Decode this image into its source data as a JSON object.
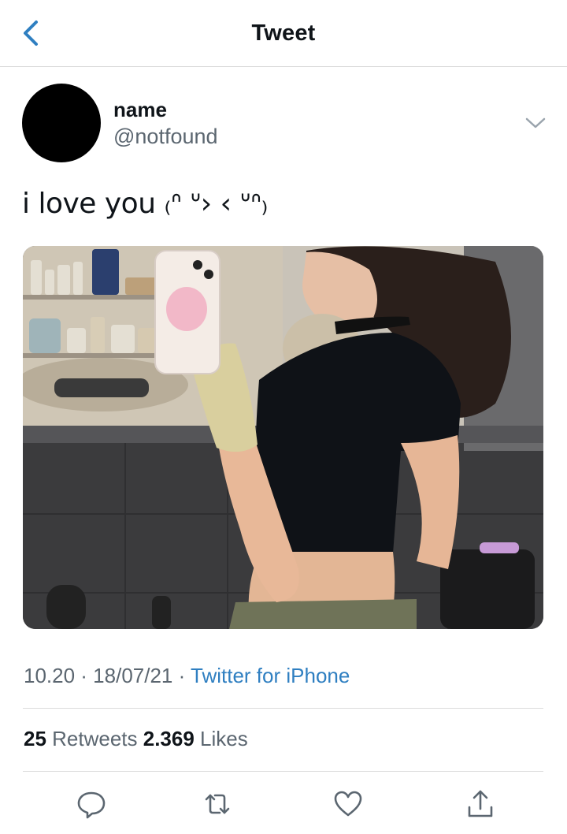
{
  "header": {
    "title": "Tweet"
  },
  "author": {
    "name": "name",
    "handle": "@notfound"
  },
  "tweet": {
    "text": "i love you ₍ᐢ ᐡ›  ‹ ᐡᐢ₎",
    "timestamp": "10.20 · 18/07/21 · ",
    "source": "Twitter for iPhone"
  },
  "stats": {
    "retweets_count": "25",
    "retweets_label": " Retweets ",
    "likes_count": "2.369",
    "likes_label": " Likes"
  },
  "icons": {
    "back": "chevron-left-icon",
    "more": "chevron-down-icon",
    "reply": "reply-icon",
    "retweet": "retweet-icon",
    "like": "heart-icon",
    "share": "share-icon"
  },
  "colors": {
    "accent": "#2f7fc1",
    "secondary_text": "#5b6670"
  }
}
